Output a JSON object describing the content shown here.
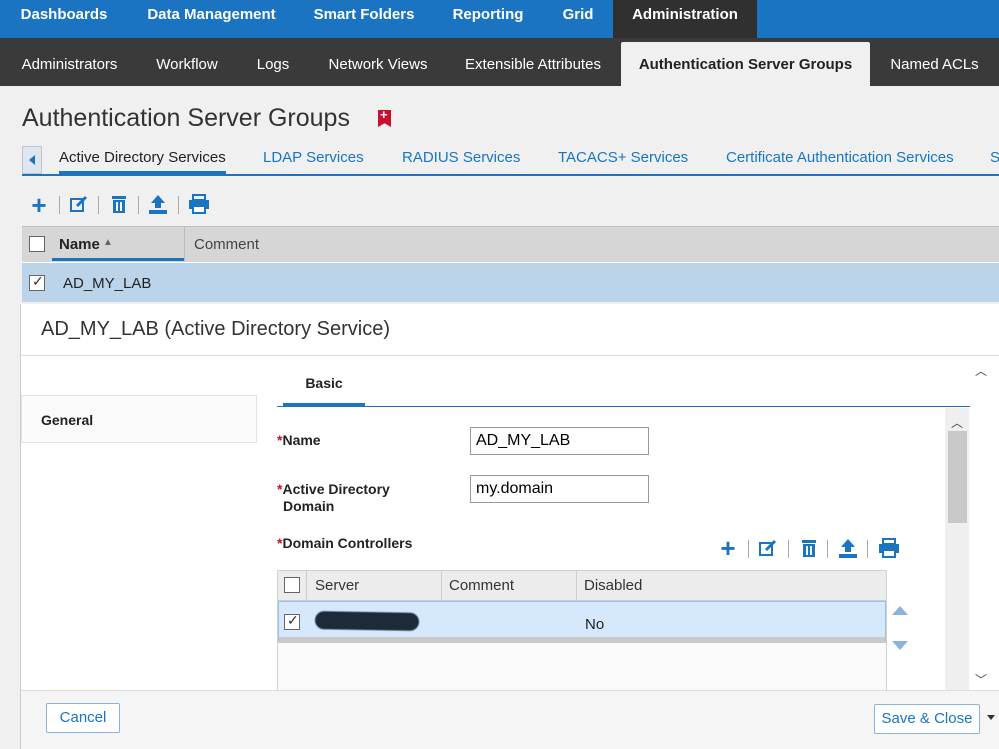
{
  "top_nav": [
    "Dashboards",
    "Data Management",
    "Smart Folders",
    "Reporting",
    "Grid",
    "Administration"
  ],
  "sub_nav": [
    "Administrators",
    "Workflow",
    "Logs",
    "Network Views",
    "Extensible Attributes",
    "Authentication Server Groups",
    "Named ACLs"
  ],
  "page": {
    "title": "Authentication Server Groups",
    "tabs": [
      "Active Directory Services",
      "LDAP Services",
      "RADIUS Services",
      "TACACS+ Services",
      "Certificate Authentication Services",
      "S"
    ],
    "grid": {
      "columns": [
        "Name",
        "Comment"
      ],
      "rows": [
        {
          "name": "AD_MY_LAB",
          "comment": "",
          "checked": true
        }
      ]
    }
  },
  "modal": {
    "title": "AD_MY_LAB (Active Directory Service)",
    "left_nav": [
      "General"
    ],
    "tab": "Basic",
    "required_mark": "*",
    "fields": {
      "name_label": "Name",
      "name_value": "AD_MY_LAB",
      "domain_label_line1": "Active Directory",
      "domain_label_line2": "Domain",
      "domain_value": "my.domain",
      "controllers_label": "Domain Controllers"
    },
    "controllers_table": {
      "columns": [
        "Server",
        "Comment",
        "Disabled"
      ],
      "rows": [
        {
          "server": "",
          "comment": "",
          "disabled": "No",
          "checked": true
        }
      ]
    },
    "buttons": {
      "cancel": "Cancel",
      "save_close": "Save & Close"
    }
  },
  "icons": [
    "add-icon",
    "edit-icon",
    "delete-icon",
    "export-icon",
    "print-icon"
  ],
  "colors": {
    "brand_blue": "#1a74c2",
    "selected_row": "#bcd4ea",
    "required": "#c8102e"
  }
}
